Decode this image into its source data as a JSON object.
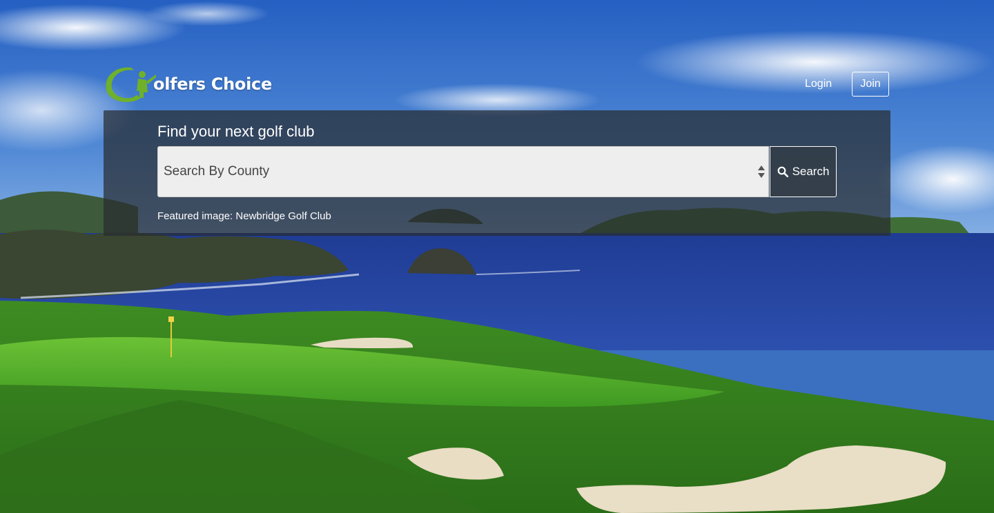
{
  "brand": {
    "logo_text": "olfers Choice",
    "accent_color": "#6fb12a"
  },
  "nav": {
    "login_label": "Login",
    "join_label": "Join"
  },
  "search": {
    "heading": "Find your next golf club",
    "county_select_value": "Search By County",
    "button_label": "Search",
    "button_icon": "search-icon"
  },
  "featured": {
    "caption": "Featured image: Newbridge Golf Club"
  },
  "colors": {
    "sky_top": "#2e6ac6",
    "sea": "#2f4fa6",
    "grass": "#4fae2a",
    "sand": "#e8dcc0",
    "panel": "#282c30"
  }
}
